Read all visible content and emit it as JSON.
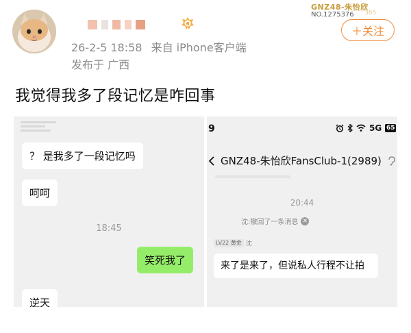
{
  "post": {
    "time": "26-2-5 18:58",
    "source": "来自 iPhone客户端",
    "location": "发布于 广西",
    "text": "我觉得我多了段记忆是咋回事",
    "follow_label": "＋关注"
  },
  "fan_badge": {
    "title": "GNZ48-朱怡欣",
    "number": "NO.1275376",
    "watermark": "365"
  },
  "left_chat": {
    "messages": [
      {
        "text": "？ 是我多了一段记忆吗",
        "side": "left"
      },
      {
        "text": "呵呵",
        "side": "left"
      },
      {
        "text": "笑死我了",
        "side": "right"
      },
      {
        "text": "逆天",
        "side": "left"
      }
    ],
    "time": "18:45"
  },
  "right_chat": {
    "status_bar_time": "9",
    "status_icons": [
      "alarm-icon",
      "bluetooth-icon",
      "wifi-icon",
      "5g-signal-icon",
      "battery-icon"
    ],
    "signal_text": "5G",
    "battery_text": "65",
    "group_name": "GNZ48-朱怡欣FansClub-1(2989)",
    "time": "20:44",
    "recall_notice": "沈:撤回了一条消息",
    "sender_level": "LV22",
    "sender_tag": "黄金",
    "sender_name": "沈",
    "message": "来了是来了，但说私人行程不让拍"
  },
  "colors": {
    "accent": "#f28c3a",
    "meta_gray": "#8a8a8a",
    "wechat_green": "#95ec69",
    "chat_bg": "#f0f0f0",
    "fan_gold": "#c99b3a"
  }
}
